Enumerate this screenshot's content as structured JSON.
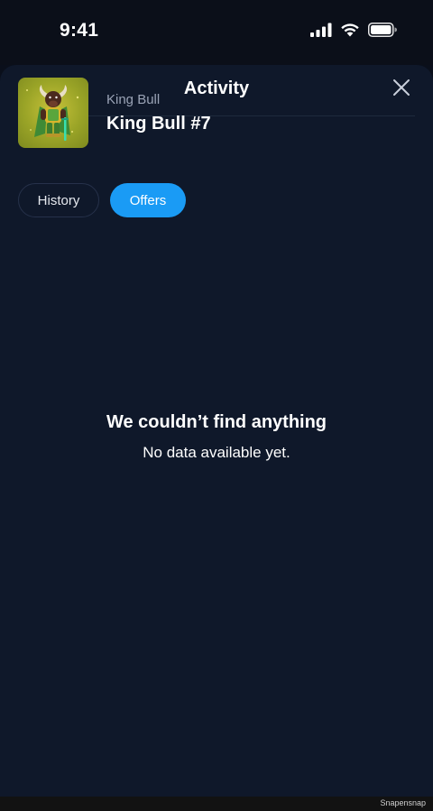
{
  "status_bar": {
    "time": "9:41",
    "icons": [
      "signal-icon",
      "wifi-icon",
      "battery-icon"
    ]
  },
  "sheet": {
    "title": "Activity",
    "close_icon": "close-icon"
  },
  "item": {
    "collection": "King Bull",
    "name": "King Bull #7",
    "thumbnail": "king-bull-nft-image"
  },
  "tabs": [
    {
      "label": "History",
      "active": false
    },
    {
      "label": "Offers",
      "active": true
    }
  ],
  "empty_state": {
    "title": "We couldn’t find anything",
    "subtitle": "No data available yet."
  },
  "footer": {
    "watermark": "Snapensnap"
  },
  "colors": {
    "background": "#0f182a",
    "accent": "#1a9bf5",
    "muted_text": "#9aa3b6"
  }
}
